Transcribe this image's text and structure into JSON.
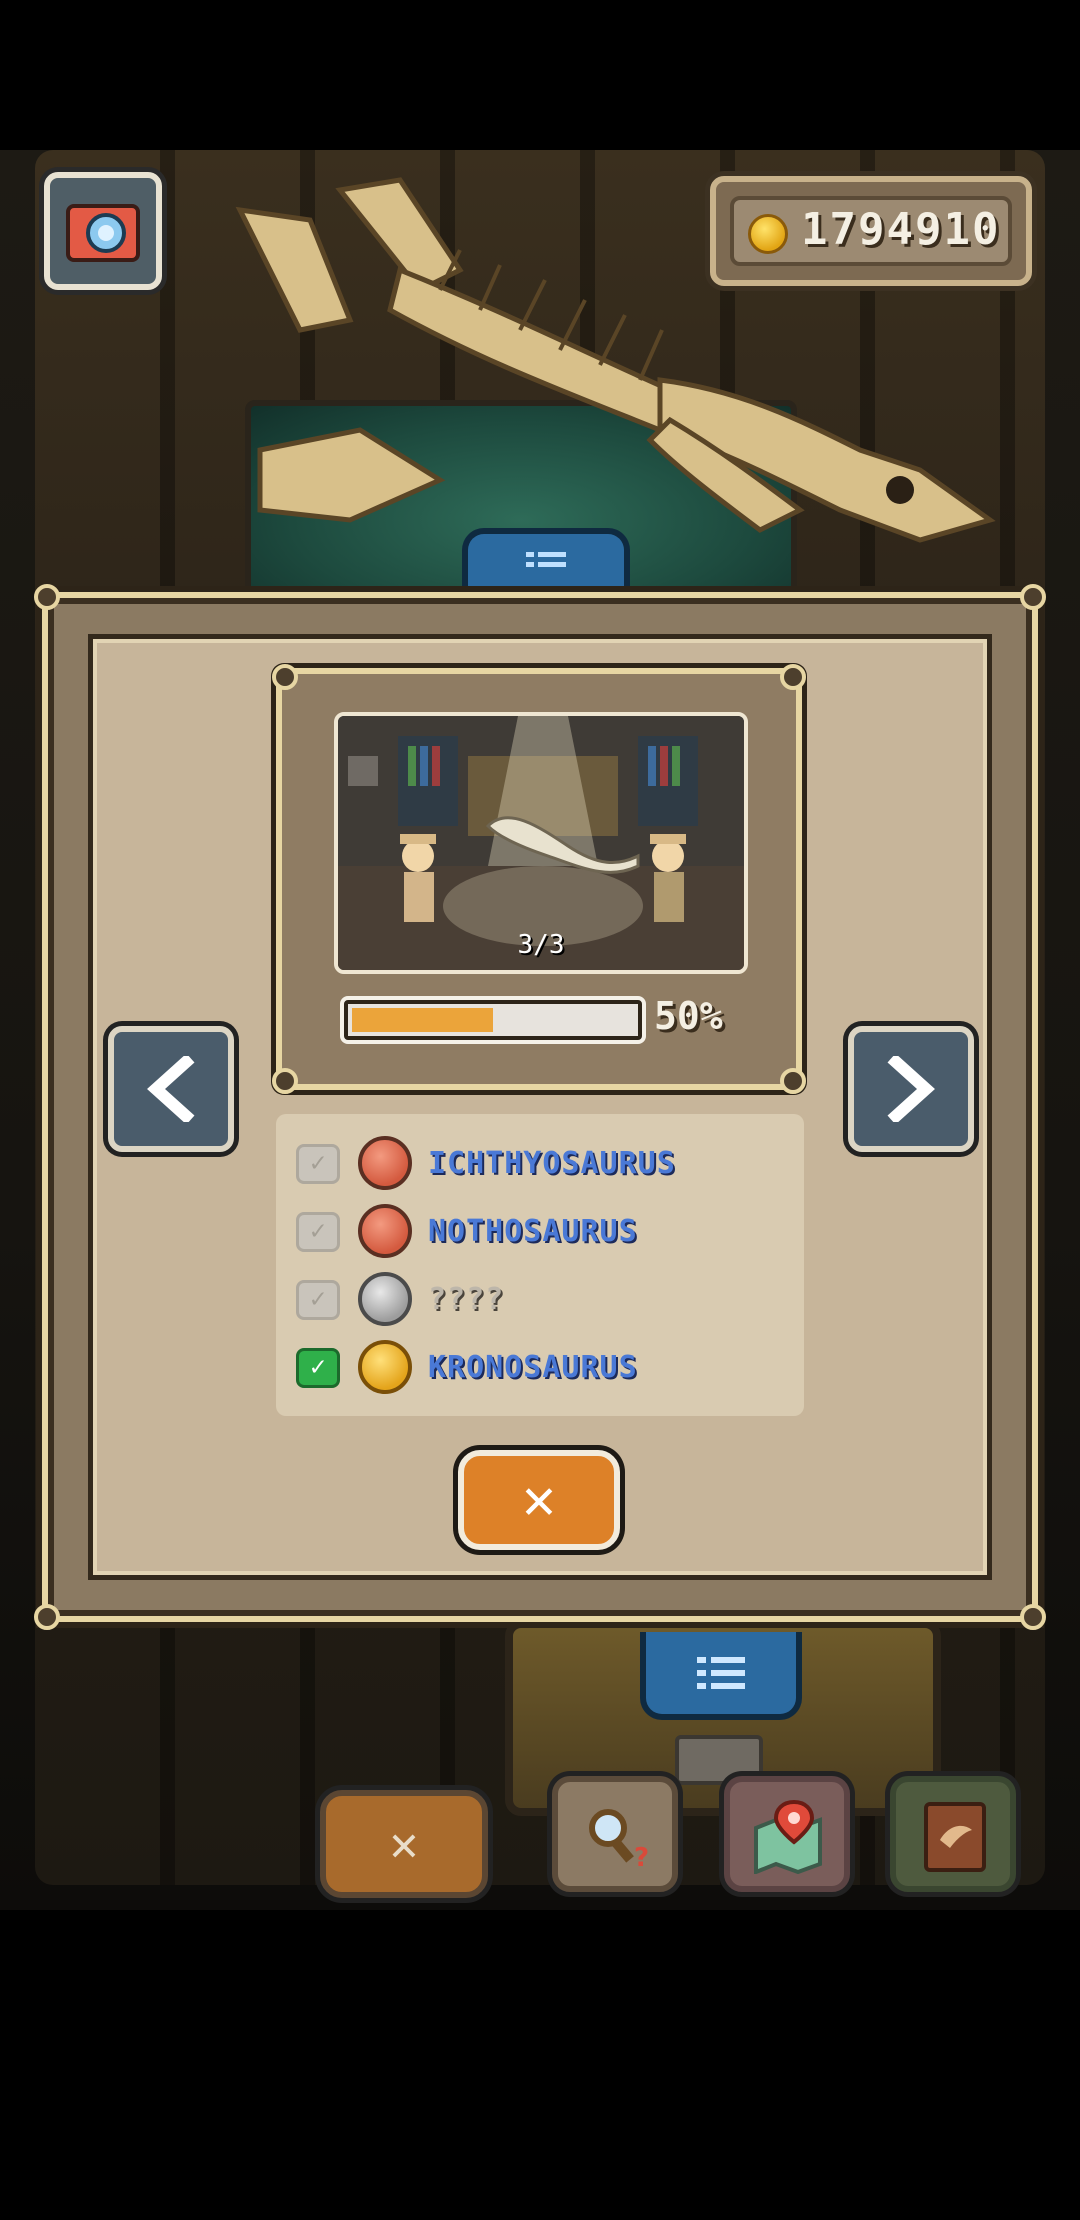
{
  "hud": {
    "coins": "1794910",
    "coin_icon": "coin-icon",
    "camera_icon": "camera-icon"
  },
  "modal": {
    "photo_counter": "3/3",
    "progress_percent": 50,
    "progress_label": "50%",
    "prev_icon": "chevron-left-icon",
    "next_icon": "chevron-right-icon",
    "close_icon": "close-icon",
    "species": [
      {
        "name": "ICHTHYOSAURUS",
        "checked": false,
        "badge": "red"
      },
      {
        "name": "NOTHOSAURUS",
        "checked": false,
        "badge": "red"
      },
      {
        "name": "????",
        "checked": false,
        "badge": "grey"
      },
      {
        "name": "KRONOSAURUS",
        "checked": true,
        "badge": "gold"
      }
    ]
  },
  "toolbar": {
    "close_icon": "close-icon",
    "search_icon": "magnifier-question-icon",
    "map_icon": "map-pin-icon",
    "book_icon": "book-icon"
  },
  "colors": {
    "accent_orange": "#dd8128",
    "progress_fill": "#eba43a",
    "species_text": "#4a79d6",
    "check_green": "#2fb04a"
  }
}
